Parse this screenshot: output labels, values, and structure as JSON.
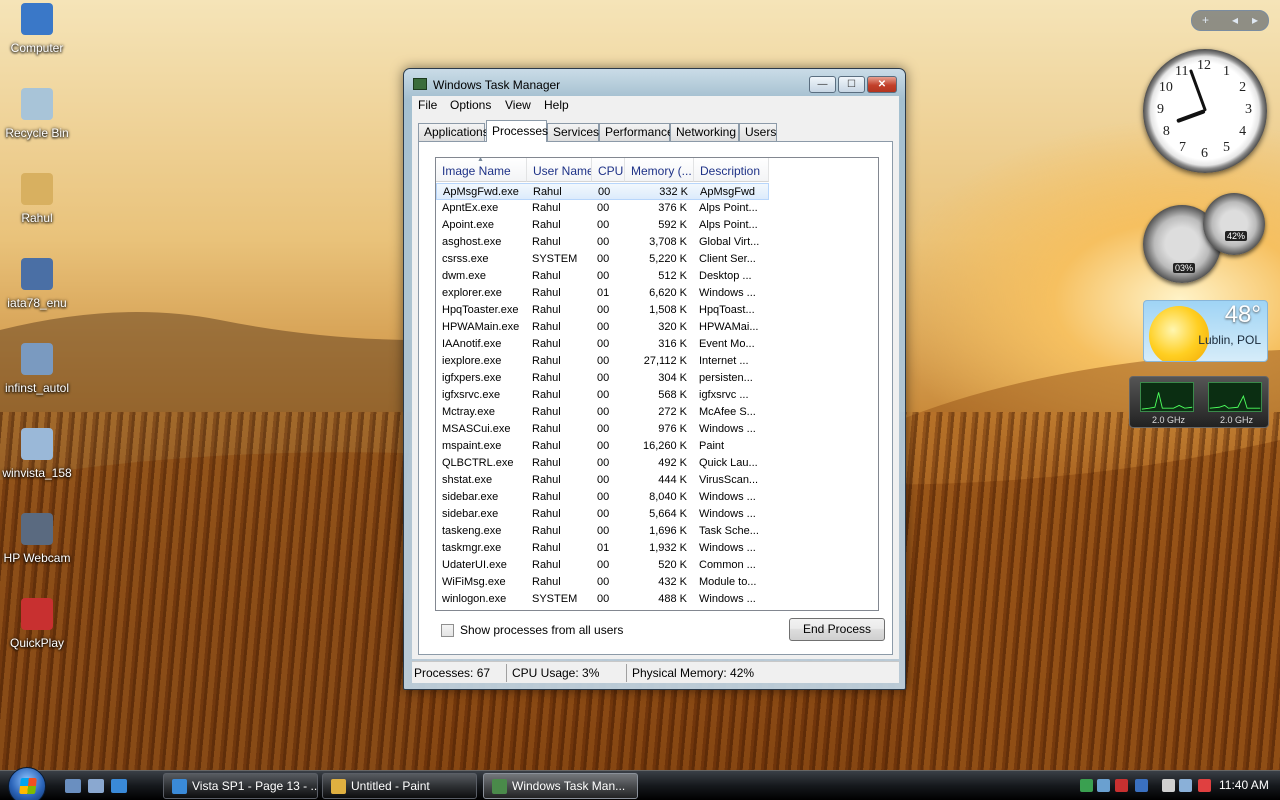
{
  "desktop": {
    "icons": [
      {
        "label": "Computer",
        "icon": "computer-icon",
        "color": "#3a78c8"
      },
      {
        "label": "Recycle Bin",
        "icon": "recycle-bin-icon",
        "color": "#a8c4d8"
      },
      {
        "label": "Rahul",
        "icon": "user-folder-icon",
        "color": "#d8b060"
      },
      {
        "label": "iata78_enu",
        "icon": "installer-icon",
        "color": "#4a6fa5"
      },
      {
        "label": "infinst_autol",
        "icon": "setup-icon",
        "color": "#7a9ac0"
      },
      {
        "label": "winvista_158",
        "icon": "image-file-icon",
        "color": "#9ab8d8"
      },
      {
        "label": "HP Webcam",
        "icon": "webcam-icon",
        "color": "#5a6a80"
      },
      {
        "label": "QuickPlay",
        "icon": "quickplay-icon",
        "color": "#c83030"
      }
    ]
  },
  "window": {
    "title": "Windows Task Manager",
    "buttons": {
      "minimize": "—",
      "maximize": "☐",
      "close": "✕"
    },
    "menu": [
      "File",
      "Options",
      "View",
      "Help"
    ],
    "tabs": [
      "Applications",
      "Processes",
      "Services",
      "Performance",
      "Networking",
      "Users"
    ],
    "active_tab": "Processes",
    "columns": [
      "Image Name",
      "User Name",
      "CPU",
      "Memory (...",
      "Description"
    ],
    "processes": [
      {
        "name": "ApMsgFwd.exe",
        "user": "Rahul",
        "cpu": "00",
        "mem": "332 K",
        "desc": "ApMsgFwd"
      },
      {
        "name": "ApntEx.exe",
        "user": "Rahul",
        "cpu": "00",
        "mem": "376 K",
        "desc": "Alps Point..."
      },
      {
        "name": "Apoint.exe",
        "user": "Rahul",
        "cpu": "00",
        "mem": "592 K",
        "desc": "Alps Point..."
      },
      {
        "name": "asghost.exe",
        "user": "Rahul",
        "cpu": "00",
        "mem": "3,708 K",
        "desc": "Global Virt..."
      },
      {
        "name": "csrss.exe",
        "user": "SYSTEM",
        "cpu": "00",
        "mem": "5,220 K",
        "desc": "Client Ser..."
      },
      {
        "name": "dwm.exe",
        "user": "Rahul",
        "cpu": "00",
        "mem": "512 K",
        "desc": "Desktop ..."
      },
      {
        "name": "explorer.exe",
        "user": "Rahul",
        "cpu": "01",
        "mem": "6,620 K",
        "desc": "Windows ..."
      },
      {
        "name": "HpqToaster.exe",
        "user": "Rahul",
        "cpu": "00",
        "mem": "1,508 K",
        "desc": "HpqToast..."
      },
      {
        "name": "HPWAMain.exe",
        "user": "Rahul",
        "cpu": "00",
        "mem": "320 K",
        "desc": "HPWAMai..."
      },
      {
        "name": "IAAnotif.exe",
        "user": "Rahul",
        "cpu": "00",
        "mem": "316 K",
        "desc": "Event Mo..."
      },
      {
        "name": "iexplore.exe",
        "user": "Rahul",
        "cpu": "00",
        "mem": "27,112 K",
        "desc": "Internet ..."
      },
      {
        "name": "igfxpers.exe",
        "user": "Rahul",
        "cpu": "00",
        "mem": "304 K",
        "desc": "persisten..."
      },
      {
        "name": "igfxsrvc.exe",
        "user": "Rahul",
        "cpu": "00",
        "mem": "568 K",
        "desc": "igfxsrvc ..."
      },
      {
        "name": "Mctray.exe",
        "user": "Rahul",
        "cpu": "00",
        "mem": "272 K",
        "desc": "McAfee S..."
      },
      {
        "name": "MSASCui.exe",
        "user": "Rahul",
        "cpu": "00",
        "mem": "976 K",
        "desc": "Windows ..."
      },
      {
        "name": "mspaint.exe",
        "user": "Rahul",
        "cpu": "00",
        "mem": "16,260 K",
        "desc": "Paint"
      },
      {
        "name": "QLBCTRL.exe",
        "user": "Rahul",
        "cpu": "00",
        "mem": "492 K",
        "desc": "Quick Lau..."
      },
      {
        "name": "shstat.exe",
        "user": "Rahul",
        "cpu": "00",
        "mem": "444 K",
        "desc": "VirusScan..."
      },
      {
        "name": "sidebar.exe",
        "user": "Rahul",
        "cpu": "00",
        "mem": "8,040 K",
        "desc": "Windows ..."
      },
      {
        "name": "sidebar.exe",
        "user": "Rahul",
        "cpu": "00",
        "mem": "5,664 K",
        "desc": "Windows ..."
      },
      {
        "name": "taskeng.exe",
        "user": "Rahul",
        "cpu": "00",
        "mem": "1,696 K",
        "desc": "Task Sche..."
      },
      {
        "name": "taskmgr.exe",
        "user": "Rahul",
        "cpu": "01",
        "mem": "1,932 K",
        "desc": "Windows ..."
      },
      {
        "name": "UdaterUI.exe",
        "user": "Rahul",
        "cpu": "00",
        "mem": "520 K",
        "desc": "Common ..."
      },
      {
        "name": "WiFiMsg.exe",
        "user": "Rahul",
        "cpu": "00",
        "mem": "432 K",
        "desc": "Module to..."
      },
      {
        "name": "winlogon.exe",
        "user": "SYSTEM",
        "cpu": "00",
        "mem": "488 K",
        "desc": "Windows ..."
      }
    ],
    "selected_index": 0,
    "show_all_label": "Show processes from all users",
    "show_all_checked": false,
    "end_process_label": "End Process",
    "status": {
      "processes": "Processes: 67",
      "cpu": "CPU Usage: 3%",
      "memory": "Physical Memory: 42%"
    }
  },
  "taskbar": {
    "quicklaunch": [
      {
        "icon": "show-desktop-icon",
        "color": "#6a8fc0"
      },
      {
        "icon": "switch-windows-icon",
        "color": "#8aa8d0"
      },
      {
        "icon": "internet-explorer-icon",
        "color": "#3a8ad8"
      }
    ],
    "buttons": [
      {
        "label": "Vista SP1 - Page 13 - ...",
        "icon": "internet-explorer-icon",
        "color": "#3a8ad8",
        "active": false
      },
      {
        "label": "Untitled - Paint",
        "icon": "paint-icon",
        "color": "#e0b040",
        "active": false
      },
      {
        "label": "Windows Task Man...",
        "icon": "task-manager-icon",
        "color": "#4a8a4a",
        "active": true
      }
    ],
    "tray_icons": [
      {
        "icon": "tray-green-icon",
        "color": "#3aa050"
      },
      {
        "icon": "tray-network-icon",
        "color": "#6aa0d0"
      },
      {
        "icon": "tray-shield-icon",
        "color": "#c83030"
      },
      {
        "icon": "tray-blue-icon",
        "color": "#3a70c0"
      },
      {
        "icon": "tray-device-icon",
        "color": "#d0d0d0"
      },
      {
        "icon": "tray-network2-icon",
        "color": "#8ab0d8"
      },
      {
        "icon": "tray-volume-muted-icon",
        "color": "#e04040"
      }
    ],
    "clock": "11:40 AM"
  },
  "gadgets": {
    "sidebar_controls": [
      "+",
      "◂",
      "▸"
    ],
    "clock_numbers": [
      "12",
      "1",
      "2",
      "3",
      "4",
      "5",
      "6",
      "7",
      "8",
      "9",
      "10",
      "11"
    ],
    "cpu_meter": "03%",
    "memory_meter": "42%",
    "weather": {
      "temp": "48°",
      "city": "Lublin, POL"
    },
    "cpu_freq": [
      "2.0 GHz",
      "2.0 GHz"
    ]
  }
}
